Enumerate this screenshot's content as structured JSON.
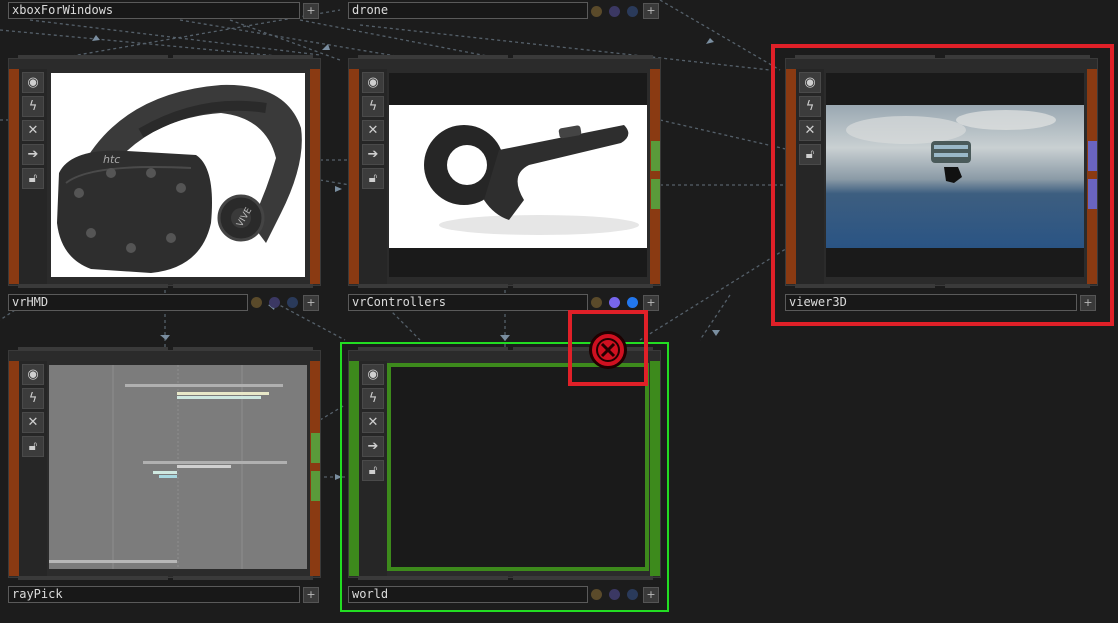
{
  "nodes": {
    "xbox": {
      "name": "xboxForWindows"
    },
    "drone": {
      "name": "drone"
    },
    "vrHMD": {
      "name": "vrHMD",
      "image_brand": "htc",
      "image_side_text": "VIVE"
    },
    "vrControllers": {
      "name": "vrControllers"
    },
    "viewer3D": {
      "name": "viewer3D"
    },
    "rayPick": {
      "name": "rayPick"
    },
    "world": {
      "name": "world"
    }
  },
  "node_buttons": [
    "viewer-toggle-icon",
    "bypass-icon",
    "close-icon",
    "cook-arrow-icon",
    "lock-icon"
  ],
  "colors": {
    "background": "#1c1c1c",
    "rail_orange": "#8a3a12",
    "rail_green": "#3d8a1c",
    "selection_red": "#e02028",
    "selection_green": "#22dd22",
    "error_red": "#d01020",
    "flag_purple": "#7766ee",
    "flag_blue": "#2277ee"
  }
}
